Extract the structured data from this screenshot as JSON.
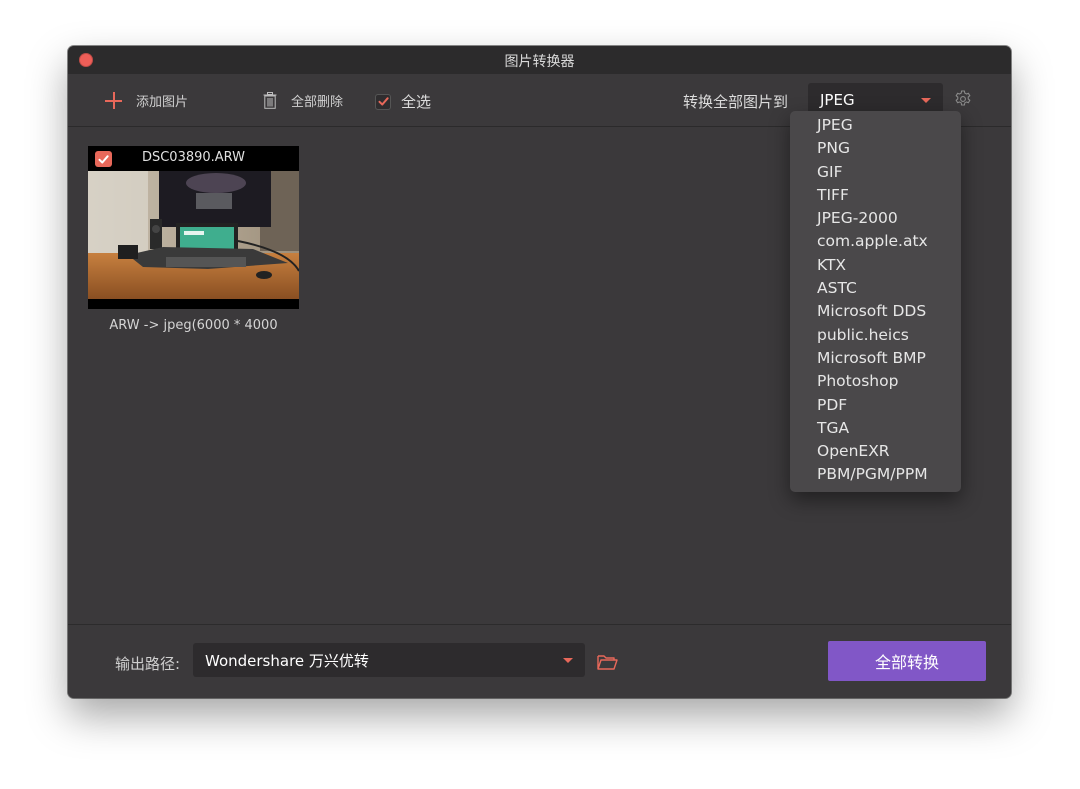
{
  "window": {
    "title": "图片转换器"
  },
  "toolbar": {
    "add_label": "添加图片",
    "delete_all_label": "全部删除",
    "select_all_label": "全选",
    "select_all_checked": true,
    "convert_all_to_label": "转换全部图片到",
    "format_selected": "JPEG"
  },
  "format_options": [
    "JPEG",
    "PNG",
    "GIF",
    "TIFF",
    "JPEG-2000",
    "com.apple.atx",
    "KTX",
    "ASTC",
    "Microsoft DDS",
    "public.heics",
    "Microsoft BMP",
    "Photoshop",
    "PDF",
    "TGA",
    "OpenEXR",
    "PBM/PGM/PPM"
  ],
  "images": [
    {
      "filename": "DSC03890.ARW",
      "caption": "ARW -> jpeg(6000 * 4000",
      "checked": true
    }
  ],
  "footer": {
    "output_label": "输出路径:",
    "output_path": "Wondershare 万兴优转",
    "convert_all_button": "全部转换"
  },
  "colors": {
    "accent": "#e8685a",
    "primary_button": "#8157c7",
    "window_bg": "#3b393b",
    "titlebar_bg": "#2c2b2c",
    "dropdown_bg": "#4a484a"
  }
}
